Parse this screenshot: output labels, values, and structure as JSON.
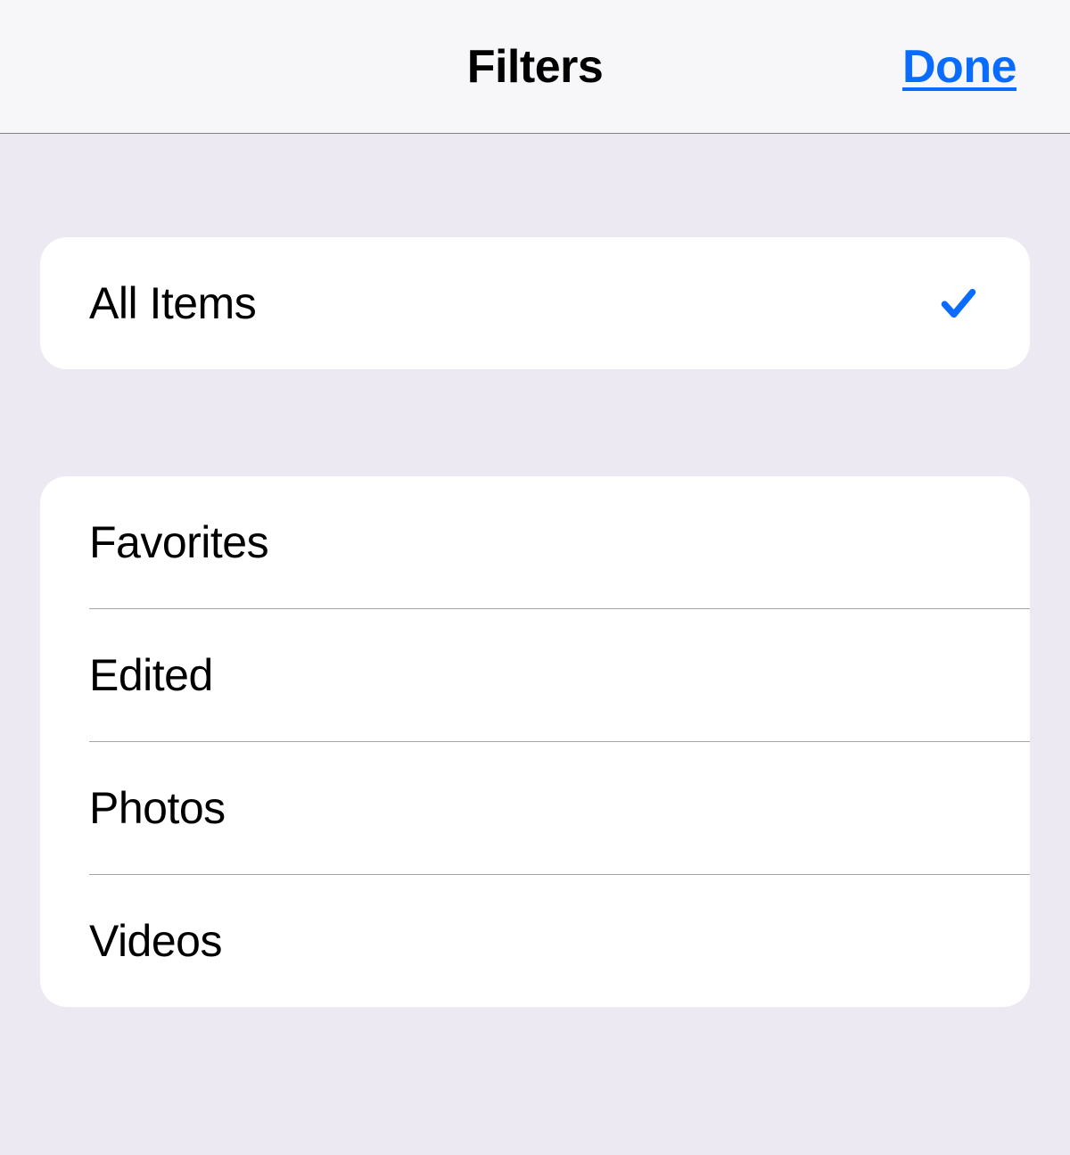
{
  "header": {
    "title": "Filters",
    "done_label": "Done"
  },
  "colors": {
    "accent": "#0a6cff",
    "bg": "#ece9f2",
    "header_bg": "#f7f6f9",
    "divider": "#a6a6a9"
  },
  "groups": [
    {
      "items": [
        {
          "label": "All Items",
          "selected": true
        }
      ]
    },
    {
      "items": [
        {
          "label": "Favorites",
          "selected": false
        },
        {
          "label": "Edited",
          "selected": false
        },
        {
          "label": "Photos",
          "selected": false
        },
        {
          "label": "Videos",
          "selected": false
        }
      ]
    }
  ]
}
